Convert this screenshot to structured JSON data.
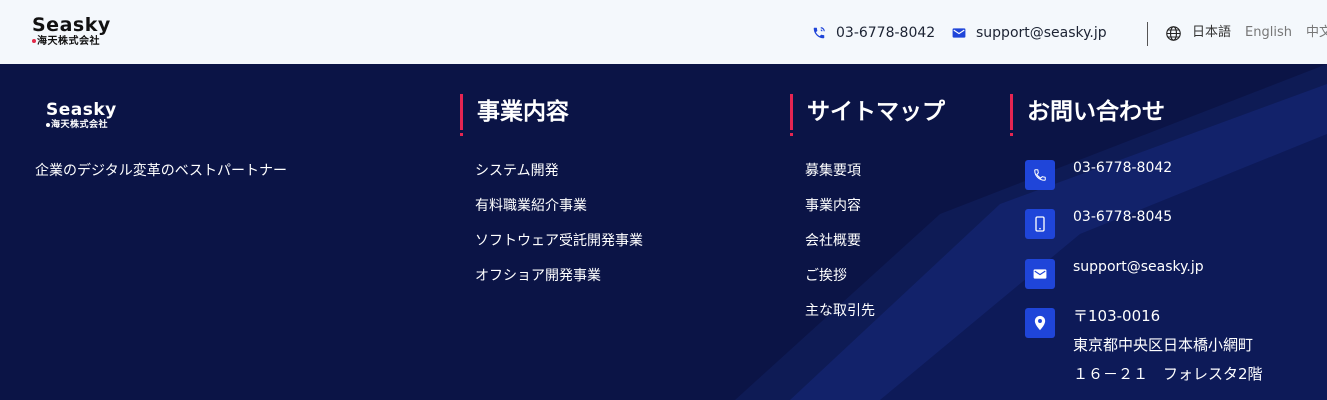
{
  "header": {
    "logo": {
      "brand": "Seasky",
      "sub": "海天株式会社"
    },
    "phone": "03-6778-8042",
    "email": "support@seasky.jp",
    "languages": [
      "日本語",
      "English",
      "中文"
    ]
  },
  "footer": {
    "logo": {
      "brand": "Seasky",
      "sub": "海天株式会社"
    },
    "tagline": "企業のデジタル変革のベストパートナー",
    "business": {
      "title": "事業内容",
      "items": [
        "システム開発",
        "有料職業紹介事業",
        "ソフトウェア受託開発事業",
        "オフショア開発事業"
      ]
    },
    "sitemap": {
      "title": "サイトマップ",
      "items": [
        "募集要項",
        "事業内容",
        "会社概要",
        "ご挨拶",
        "主な取引先"
      ]
    },
    "contact": {
      "title": "お問い合わせ",
      "phone": "03-6778-8042",
      "mobile": "03-6778-8045",
      "email": "support@seasky.jp",
      "address": [
        "〒103-0016",
        "東京都中央区日本橋小網町",
        "１６－２１　フォレスタ2階"
      ]
    }
  },
  "colors": {
    "footer_bg": "#0b1446",
    "accent_red": "#e52552",
    "icon_blue": "#1f45d9",
    "header_bg": "#f4f8fc"
  },
  "icons": [
    "phone-icon",
    "mail-icon",
    "globe-icon",
    "smartphone-icon",
    "location-pin-icon"
  ]
}
